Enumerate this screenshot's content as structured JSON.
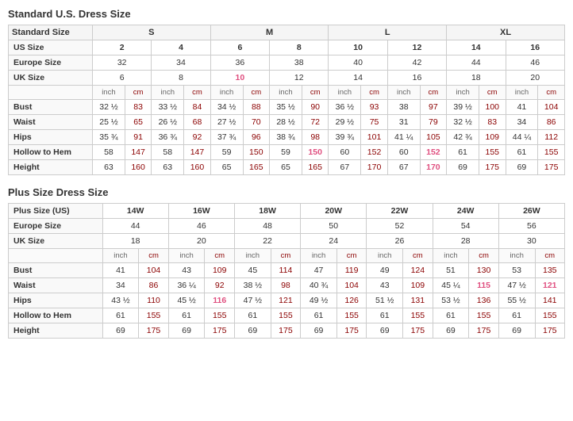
{
  "standard": {
    "title": "Standard U.S. Dress Size",
    "size_groups": [
      "S",
      "M",
      "L",
      "XL"
    ],
    "us_sizes": [
      "2",
      "4",
      "6",
      "8",
      "10",
      "12",
      "14",
      "16"
    ],
    "europe_sizes": [
      "32",
      "34",
      "36",
      "38",
      "40",
      "42",
      "44",
      "46"
    ],
    "uk_sizes": [
      "6",
      "8",
      "10",
      "12",
      "14",
      "16",
      "18",
      "20"
    ],
    "uk_highlights": [
      false,
      false,
      true,
      false,
      false,
      false,
      false,
      false
    ],
    "measurements": [
      {
        "label": "Bust",
        "values": [
          "32 ½",
          "83",
          "33 ½",
          "84",
          "34 ½",
          "88",
          "35 ½",
          "90",
          "36 ½",
          "93",
          "38",
          "97",
          "39 ½",
          "100",
          "41",
          "104"
        ]
      },
      {
        "label": "Waist",
        "values": [
          "25 ½",
          "65",
          "26 ½",
          "68",
          "27 ½",
          "70",
          "28 ½",
          "72",
          "29 ½",
          "75",
          "31",
          "79",
          "32 ½",
          "83",
          "34",
          "86"
        ]
      },
      {
        "label": "Hips",
        "values": [
          "35 ¾",
          "91",
          "36 ¾",
          "92",
          "37 ¾",
          "96",
          "38 ¾",
          "98",
          "39 ¾",
          "101",
          "41 ¼",
          "105",
          "42 ¾",
          "109",
          "44 ¼",
          "112"
        ]
      },
      {
        "label": "Hollow to Hem",
        "values": [
          "58",
          "147",
          "58",
          "147",
          "59",
          "150",
          "59",
          "150",
          "60",
          "152",
          "60",
          "152",
          "61",
          "155",
          "61",
          "155"
        ],
        "highlights": [
          false,
          false,
          false,
          false,
          false,
          false,
          false,
          true,
          false,
          false,
          false,
          true,
          false,
          false,
          false,
          false
        ]
      },
      {
        "label": "Height",
        "values": [
          "63",
          "160",
          "63",
          "160",
          "65",
          "165",
          "65",
          "165",
          "67",
          "170",
          "67",
          "170",
          "69",
          "175",
          "69",
          "175"
        ],
        "highlights": [
          false,
          false,
          false,
          false,
          false,
          false,
          false,
          false,
          false,
          false,
          false,
          true,
          false,
          false,
          false,
          false
        ]
      }
    ]
  },
  "plus": {
    "title": "Plus Size Dress Size",
    "us_sizes": [
      "14W",
      "16W",
      "18W",
      "20W",
      "22W",
      "24W",
      "26W"
    ],
    "europe_sizes": [
      "44",
      "46",
      "48",
      "50",
      "52",
      "54",
      "56"
    ],
    "uk_sizes": [
      "18",
      "20",
      "22",
      "24",
      "26",
      "28",
      "30"
    ],
    "measurements": [
      {
        "label": "Bust",
        "values": [
          "41",
          "104",
          "43",
          "109",
          "45",
          "114",
          "47",
          "119",
          "49",
          "124",
          "51",
          "130",
          "53",
          "135"
        ]
      },
      {
        "label": "Waist",
        "values": [
          "34",
          "86",
          "36 ¼",
          "92",
          "38 ½",
          "98",
          "40 ¾",
          "104",
          "43",
          "109",
          "45 ¼",
          "115",
          "47 ½",
          "121"
        ],
        "highlights": [
          false,
          false,
          false,
          false,
          false,
          false,
          false,
          false,
          false,
          false,
          false,
          true,
          false,
          true
        ]
      },
      {
        "label": "Hips",
        "values": [
          "43 ½",
          "110",
          "45 ½",
          "116",
          "47 ½",
          "121",
          "49 ½",
          "126",
          "51 ½",
          "131",
          "53 ½",
          "136",
          "55 ½",
          "141"
        ],
        "highlights": [
          false,
          false,
          false,
          true,
          false,
          false,
          false,
          false,
          false,
          false,
          false,
          false,
          false,
          false
        ]
      },
      {
        "label": "Hollow to Hem",
        "values": [
          "61",
          "155",
          "61",
          "155",
          "61",
          "155",
          "61",
          "155",
          "61",
          "155",
          "61",
          "155",
          "61",
          "155"
        ]
      },
      {
        "label": "Height",
        "values": [
          "69",
          "175",
          "69",
          "175",
          "69",
          "175",
          "69",
          "175",
          "69",
          "175",
          "69",
          "175",
          "69",
          "175"
        ]
      }
    ]
  },
  "labels": {
    "standard_title": "Standard U.S. Dress Size",
    "plus_title": "Plus Size Dress Size",
    "standard_size": "Standard Size",
    "us_size": "US Size",
    "europe_size": "Europe Size",
    "uk_size": "UK Size",
    "plus_size_us": "Plus Size (US)",
    "inch": "inch",
    "cm": "cm"
  }
}
